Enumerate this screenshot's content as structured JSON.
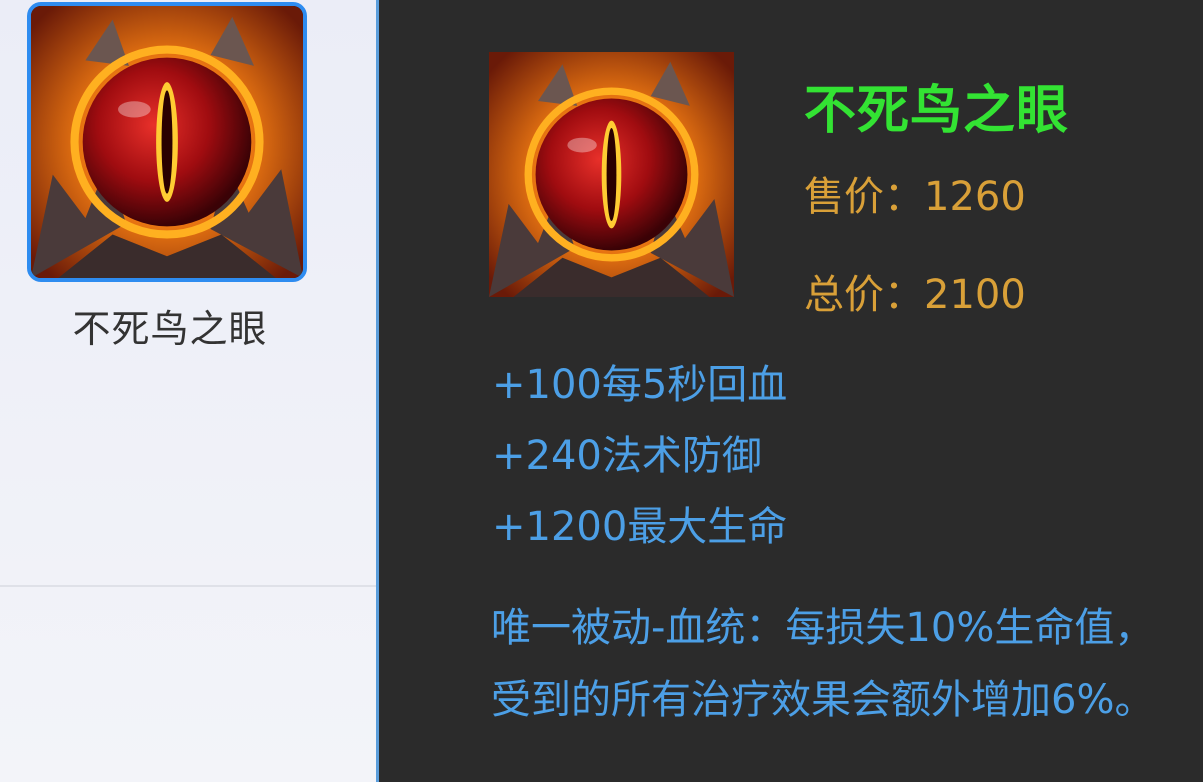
{
  "item": {
    "name": "不死鸟之眼",
    "icon": "phoenix-eye-icon"
  },
  "tooltip": {
    "title": "不死鸟之眼",
    "sell_price": "售价：1260",
    "total_price": "总价：2100",
    "stats": [
      "+100每5秒回血",
      "+240法术防御",
      "+1200最大生命"
    ],
    "passive": "唯一被动-血统：每损失10%生命值，受到的所有治疗效果会额外增加6%。"
  },
  "colors": {
    "title": "#33e333",
    "price": "#d9a038",
    "stat": "#4c9fe6",
    "tooltip_bg": "#2b2b2b",
    "selection_border": "#2e8cf0"
  }
}
